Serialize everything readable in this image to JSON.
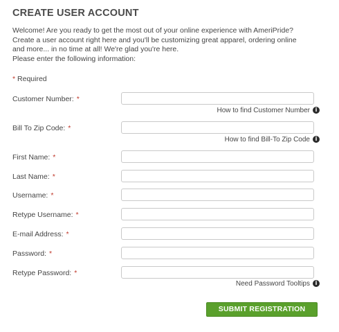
{
  "page": {
    "title": "CREATE USER ACCOUNT",
    "intro_lines": [
      "Welcome! Are you ready to get the most out of your online experience with AmeriPride?",
      "Create a user account right here and you'll be customizing great apparel, ordering online",
      "and more... in no time at all! We're glad you're here.",
      "Please enter the following information:"
    ],
    "required_star": "*",
    "required_text": "Required"
  },
  "form": {
    "fields": [
      {
        "label": "Customer Number:",
        "star": "*",
        "value": "",
        "placeholder": ""
      },
      {
        "label": "Bill To Zip Code:",
        "star": "*",
        "value": "",
        "placeholder": ""
      },
      {
        "label": "First Name:",
        "star": "*",
        "value": "",
        "placeholder": ""
      },
      {
        "label": "Last Name:",
        "star": "*",
        "value": "",
        "placeholder": ""
      },
      {
        "label": "Username:",
        "star": "*",
        "value": "",
        "placeholder": ""
      },
      {
        "label": "Retype Username:",
        "star": "*",
        "value": "",
        "placeholder": ""
      },
      {
        "label": "E-mail Address:",
        "star": "*",
        "value": "",
        "placeholder": ""
      },
      {
        "label": "Password:",
        "star": "*",
        "value": "",
        "placeholder": ""
      },
      {
        "label": "Retype Password:",
        "star": "*",
        "value": "",
        "placeholder": ""
      }
    ],
    "help": {
      "customer_number": "How to find Customer Number",
      "zip_code": "How to find Bill-To Zip Code",
      "password": "Need Password Tooltips"
    },
    "info_glyph": "i",
    "submit_label": "SUBMIT REGISTRATION"
  },
  "colors": {
    "required_star": "#c0392b",
    "submit_button": "#5aa02c",
    "text": "#454545"
  },
  "icons": {
    "help": "info-icon"
  }
}
